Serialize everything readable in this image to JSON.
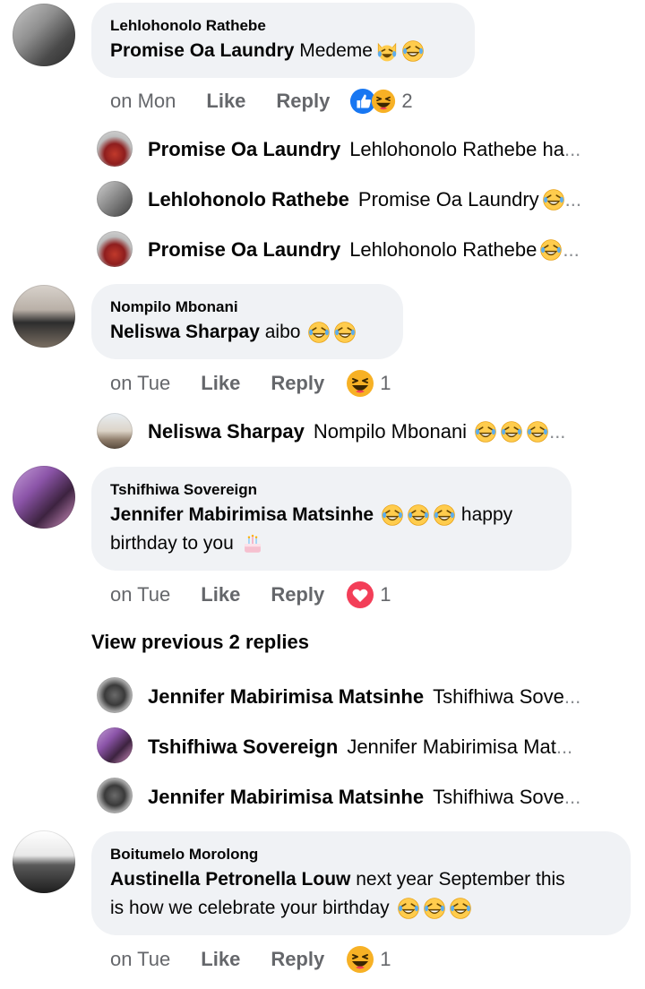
{
  "comments": [
    {
      "author": "Lehlohonolo Rathebe",
      "mention": "Promise Oa Laundry",
      "text": " Medeme",
      "time": "on Mon",
      "like_label": "Like",
      "reply_label": "Reply",
      "reaction_icons": [
        "like-reaction-icon",
        "laughing-reaction-icon"
      ],
      "reaction_count": "2",
      "replies": [
        {
          "name": "Promise Oa Laundry",
          "text": "Lehlohonolo Rathebe ha",
          "ellipsis": "..."
        },
        {
          "name": "Lehlohonolo Rathebe",
          "text": "Promise Oa Laundry",
          "ellipsis": "..."
        },
        {
          "name": "Promise Oa Laundry",
          "text": "Lehlohonolo Rathebe",
          "ellipsis": "..."
        }
      ]
    },
    {
      "author": "Nompilo Mbonani",
      "mention": "Neliswa Sharpay",
      "text": " aibo",
      "time": "on Tue",
      "like_label": "Like",
      "reply_label": "Reply",
      "reaction_icons": [
        "laughing-reaction-icon"
      ],
      "reaction_count": "1",
      "replies": [
        {
          "name": "Neliswa Sharpay",
          "text": "Nompilo Mbonani",
          "ellipsis": "..."
        }
      ]
    },
    {
      "author": "Tshifhiwa Sovereign",
      "mention": "Jennifer Mabirimisa Matsinhe",
      "text_line1_tail": " happy",
      "text_line2": "birthday to you",
      "time": "on Tue",
      "like_label": "Like",
      "reply_label": "Reply",
      "reaction_icons": [
        "love-reaction-icon"
      ],
      "reaction_count": "1",
      "view_previous": "View previous 2 replies",
      "replies": [
        {
          "name": "Jennifer Mabirimisa Matsinhe",
          "text": "Tshifhiwa Sove",
          "ellipsis": "..."
        },
        {
          "name": "Tshifhiwa Sovereign",
          "text": "Jennifer Mabirimisa Mat",
          "ellipsis": "..."
        },
        {
          "name": "Jennifer Mabirimisa Matsinhe",
          "text": "Tshifhiwa Sove",
          "ellipsis": "..."
        }
      ]
    },
    {
      "author": "Boitumelo Morolong",
      "mention": "Austinella Petronella Louw",
      "text_line1_tail": " next year September this",
      "text_line2": "is how we celebrate your birthday",
      "time": "on Tue",
      "like_label": "Like",
      "reply_label": "Reply",
      "reaction_icons": [
        "laughing-reaction-icon"
      ],
      "reaction_count": "1"
    }
  ],
  "colors": {
    "bubble": "#f0f2f5",
    "meta_text": "#65676b",
    "like_blue": "#1877f2",
    "love_red": "#f33e58",
    "haha_yellow": "#f7b125"
  }
}
